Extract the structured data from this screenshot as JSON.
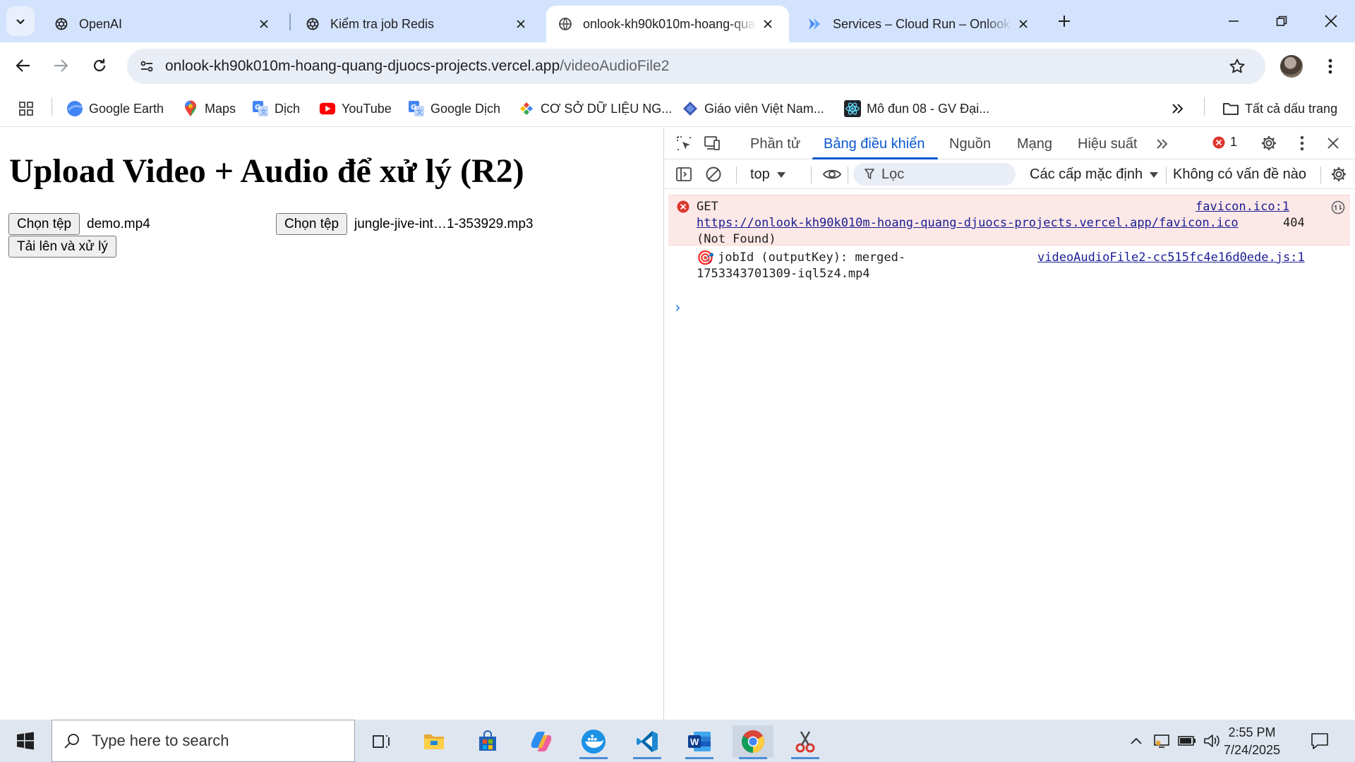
{
  "browser": {
    "tabs": [
      {
        "title": "OpenAI",
        "icon": "openai-icon"
      },
      {
        "title": "Kiểm tra job Redis",
        "icon": "openai-icon"
      },
      {
        "title": "onlook-kh90k010m-hoang-quang-djuocs-projects.vercel.app/videoAudioFile2",
        "icon": "globe-icon",
        "active": true
      },
      {
        "title": "Services – Cloud Run – Onlook",
        "icon": "cloud-run-icon"
      }
    ],
    "url_host": "onlook-kh90k010m-hoang-quang-djuocs-projects.vercel.app",
    "url_path": "/videoAudioFile2",
    "bookmarks": [
      {
        "label": "Google Earth",
        "icon": "google-earth-icon"
      },
      {
        "label": "Maps",
        "icon": "maps-pin-icon"
      },
      {
        "label": "Dịch",
        "icon": "google-translate-icon"
      },
      {
        "label": "YouTube",
        "icon": "youtube-icon"
      },
      {
        "label": "Google Dịch",
        "icon": "google-translate-icon"
      },
      {
        "label": "CƠ SỞ DỮ LIỆU NG...",
        "icon": "diamond-icon"
      },
      {
        "label": "Giáo viên Việt Nam...",
        "icon": "diamond-blue-icon"
      },
      {
        "label": "Mô đun 08 - GV Đại...",
        "icon": "react-icon"
      }
    ],
    "all_bookmarks": "Tất cả dấu trang"
  },
  "page": {
    "heading": "Upload Video + Audio để xử lý (R2)",
    "choose_file_label": "Chọn tệp",
    "video_file": "demo.mp4",
    "audio_file": "jungle-jive-int…1-353929.mp3",
    "upload_button": "Tải lên và xử lý"
  },
  "devtools": {
    "tabs": [
      "Phần tử",
      "Bảng điều khiển",
      "Nguồn",
      "Mạng",
      "Hiệu suất"
    ],
    "selected_tab": "Bảng điều khiển",
    "error_count": "1",
    "context": "top",
    "filter_placeholder": "Lọc",
    "levels": "Các cấp mặc định",
    "issues": "Không có vấn đề nào",
    "console": {
      "error": {
        "method": "GET",
        "source": "favicon.ico:1",
        "url": "https://onlook-kh90k010m-hoang-quang-djuocs-projects.vercel.app/favicon.ico",
        "status": "404",
        "status_text": "(Not Found)"
      },
      "log": {
        "emoji": "🎯",
        "line1": "jobId (outputKey): merged-",
        "line2": "1753343701309-iql5z4.mp4",
        "source": "videoAudioFile2-cc515fc4e16d0ede.js:1"
      },
      "prompt": "›"
    }
  },
  "taskbar": {
    "search_placeholder": "Type here to search",
    "time": "2:55 PM",
    "date": "7/24/2025"
  },
  "colors": {
    "tabstrip": "#d3e3fd",
    "accent": "#0b57d0",
    "error_bg": "#fce8e6",
    "link": "#1a1c93"
  }
}
